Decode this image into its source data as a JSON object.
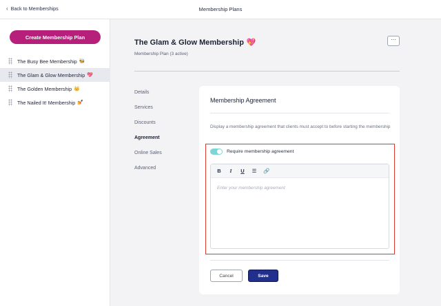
{
  "topbar": {
    "back_label": "Back to Memberships",
    "title": "Membership Plans"
  },
  "sidebar": {
    "create_label": "Create Membership Plan",
    "plans": [
      {
        "label": "The Busy Bee Membership",
        "emoji": "🐝"
      },
      {
        "label": "The Glam & Glow Membership",
        "emoji": "💖"
      },
      {
        "label": "The Golden Membership",
        "emoji": "👑"
      },
      {
        "label": "The Nailed It! Membership",
        "emoji": "💅"
      }
    ]
  },
  "main": {
    "title": "The Glam & Glow Membership",
    "title_emoji": "💖",
    "subtitle": "Membership Plan (3 active)",
    "more_label": "···",
    "nav": [
      "Details",
      "Services",
      "Discounts",
      "Agreement",
      "Online Sales",
      "Advanced"
    ]
  },
  "card": {
    "title": "Membership Agreement",
    "description": "Display a membership agreement that clients must accept to before starting the membership",
    "toggle_label": "Require membership agreement",
    "toolbar": {
      "bold": "B",
      "italic": "I",
      "underline": "U",
      "list": "☰",
      "link": "🔗"
    },
    "editor_placeholder": "Enter your membership agreement",
    "cancel_label": "Cancel",
    "save_label": "Save"
  },
  "colors": {
    "accent": "#b61f7a",
    "save": "#232f8c",
    "toggle_on": "#7fd4d7",
    "highlight": "#e0372c"
  },
  "icons": {
    "back": "chevron-left-icon",
    "drag": "drag-handle-icon",
    "more": "more-horizontal-icon"
  }
}
